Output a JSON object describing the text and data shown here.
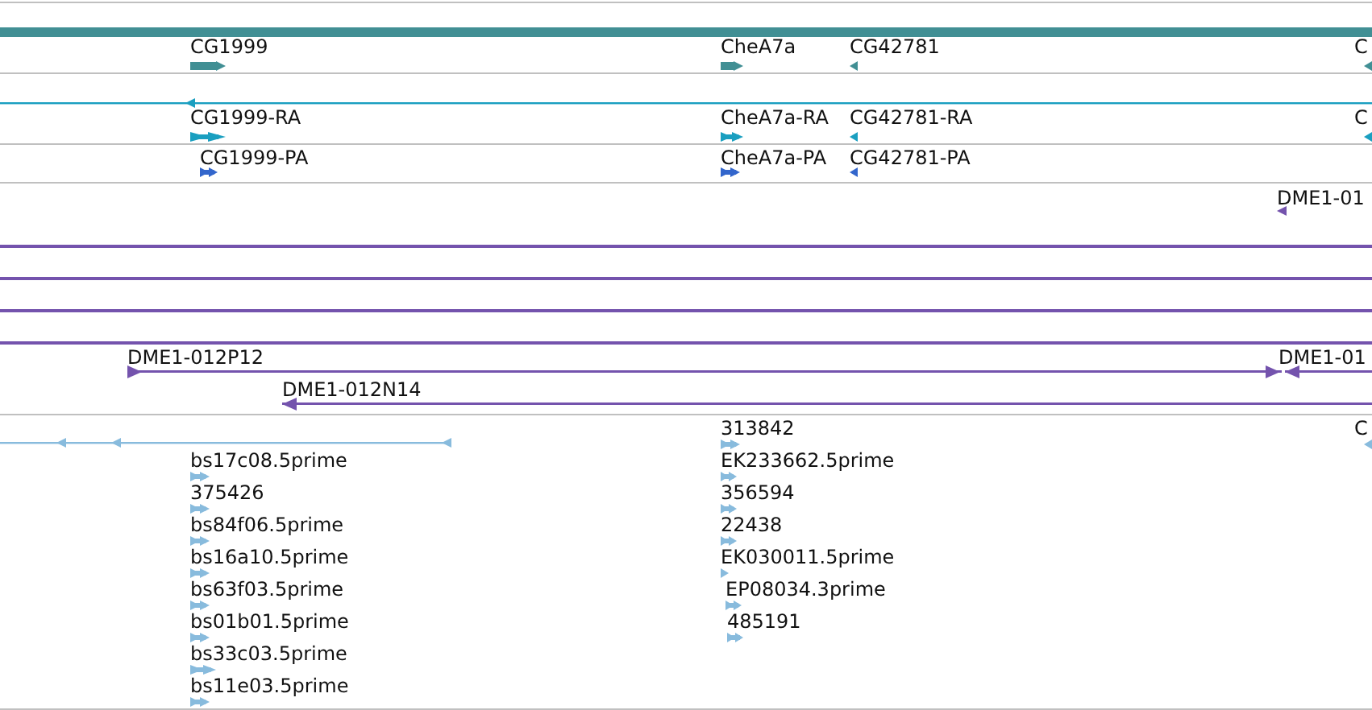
{
  "tracks": [
    {
      "kind": "gene",
      "features": [
        {
          "label": "CG1999",
          "reverse": false
        },
        {
          "label": "CheA7a",
          "reverse": false
        },
        {
          "label": "CG42781",
          "reverse": true
        },
        {
          "label": "C",
          "reverse": true
        }
      ]
    },
    {
      "kind": "transcript",
      "features": [
        {
          "label": "CG1999-RA",
          "reverse": false
        },
        {
          "label": "CheA7a-RA",
          "reverse": false
        },
        {
          "label": "CG42781-RA",
          "reverse": true
        },
        {
          "label": "C",
          "reverse": true
        }
      ]
    },
    {
      "kind": "protein",
      "features": [
        {
          "label": "CG1999-PA",
          "reverse": false
        },
        {
          "label": "CheA7a-PA",
          "reverse": false
        },
        {
          "label": "CG42781-PA",
          "reverse": true
        }
      ]
    },
    {
      "kind": "clone",
      "features": [
        {
          "label": "DME1-01",
          "reverse": true
        },
        {
          "label": "DME1-012P12",
          "reverse": false
        },
        {
          "label": "DME1-01",
          "reverse": true
        },
        {
          "label": "DME1-012N14",
          "reverse": true
        }
      ]
    },
    {
      "kind": "est",
      "features": [
        {
          "label": "313842",
          "reverse": false
        },
        {
          "label": "C",
          "reverse": true
        },
        {
          "label": "bs17c08.5prime",
          "reverse": false
        },
        {
          "label": "375426",
          "reverse": false
        },
        {
          "label": "bs84f06.5prime",
          "reverse": false
        },
        {
          "label": "bs16a10.5prime",
          "reverse": false
        },
        {
          "label": "bs63f03.5prime",
          "reverse": false
        },
        {
          "label": "bs01b01.5prime",
          "reverse": false
        },
        {
          "label": "bs33c03.5prime",
          "reverse": false
        },
        {
          "label": "bs11e03.5prime",
          "reverse": false
        },
        {
          "label": "EK233662.5prime",
          "reverse": false
        },
        {
          "label": "356594",
          "reverse": false
        },
        {
          "label": "22438",
          "reverse": false
        },
        {
          "label": "EK030011.5prime",
          "reverse": false
        },
        {
          "label": "EP08034.3prime",
          "reverse": false
        },
        {
          "label": "485191",
          "reverse": false
        }
      ]
    }
  ]
}
